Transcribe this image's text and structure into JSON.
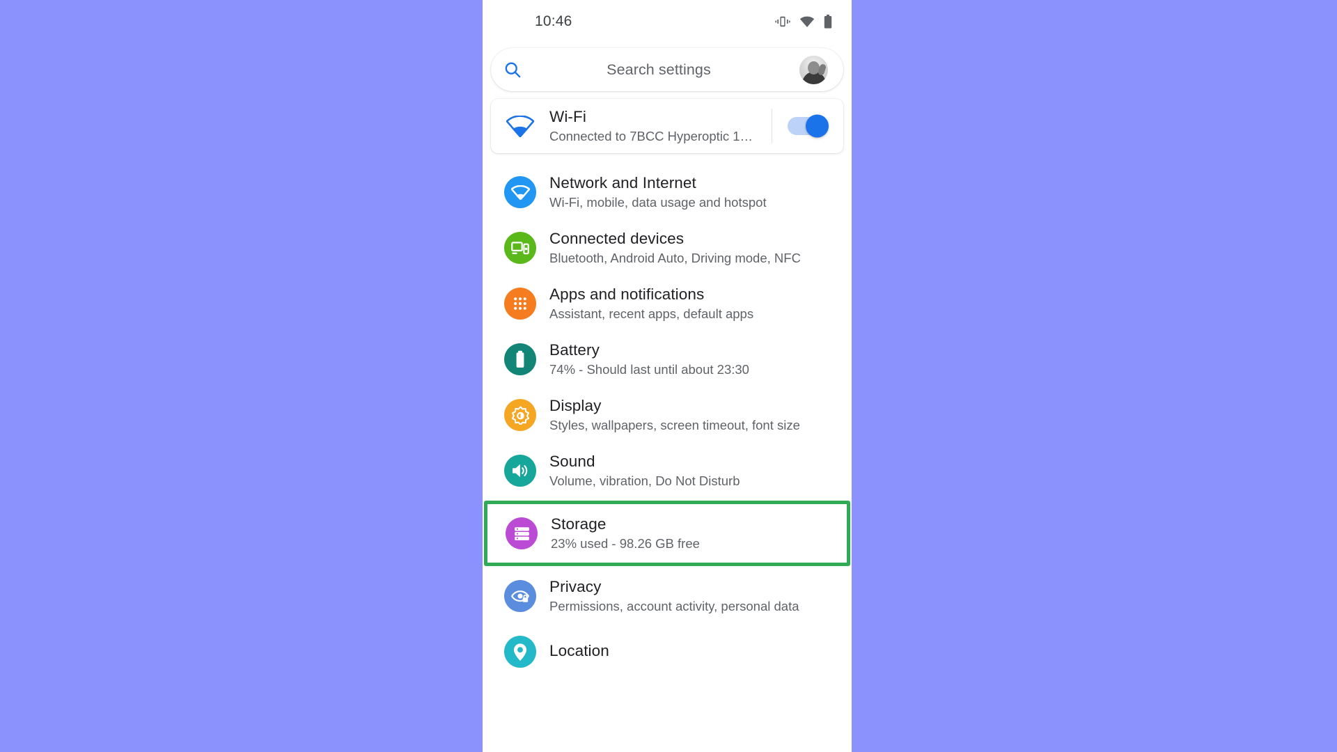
{
  "theme": {
    "background": "#8b92fd",
    "panel": "#ffffff",
    "accent_blue": "#1a73e8",
    "highlight_green": "#2fab55",
    "title_color": "#202124",
    "subtitle_color": "#5f6368"
  },
  "status_bar": {
    "clock": "10:46",
    "icons": [
      {
        "name": "vibrate-icon",
        "label": "Vibrate"
      },
      {
        "name": "wifi-icon",
        "label": "Wi-Fi"
      },
      {
        "name": "battery-icon",
        "label": "Battery"
      }
    ]
  },
  "search": {
    "placeholder": "Search settings",
    "icon": "search-icon",
    "avatar": "account-avatar"
  },
  "wifi_card": {
    "icon": "wifi-icon",
    "title": "Wi-Fi",
    "subtitle": "Connected to 7BCC Hyperoptic 1…",
    "toggle_state": "on"
  },
  "settings": {
    "items": [
      {
        "id": "network-and-internet",
        "icon": "wifi-icon",
        "icon_color": "#2196f3",
        "title": "Network and Internet",
        "subtitle": "Wi-Fi, mobile, data usage and hotspot",
        "highlighted": false
      },
      {
        "id": "connected-devices",
        "icon": "devices-icon",
        "icon_color": "#5bb81b",
        "title": "Connected devices",
        "subtitle": "Bluetooth, Android Auto, Driving mode, NFC",
        "highlighted": false
      },
      {
        "id": "apps-and-notifications",
        "icon": "apps-grid-icon",
        "icon_color": "#f57c1f",
        "title": "Apps and notifications",
        "subtitle": "Assistant, recent apps, default apps",
        "highlighted": false
      },
      {
        "id": "battery",
        "icon": "battery-icon",
        "icon_color": "#128577",
        "title": "Battery",
        "subtitle": "74% - Should last until about 23:30",
        "highlighted": false
      },
      {
        "id": "display",
        "icon": "brightness-icon",
        "icon_color": "#f5a623",
        "title": "Display",
        "subtitle": "Styles, wallpapers, screen timeout, font size",
        "highlighted": false
      },
      {
        "id": "sound",
        "icon": "volume-icon",
        "icon_color": "#16a79a",
        "title": "Sound",
        "subtitle": "Volume, vibration, Do Not Disturb",
        "highlighted": false
      },
      {
        "id": "storage",
        "icon": "storage-icon",
        "icon_color": "#bb4ad4",
        "title": "Storage",
        "subtitle": "23% used - 98.26 GB free",
        "highlighted": true
      },
      {
        "id": "privacy",
        "icon": "privacy-eye-lock-icon",
        "icon_color": "#5b8dde",
        "title": "Privacy",
        "subtitle": "Permissions, account activity, personal data",
        "highlighted": false
      },
      {
        "id": "location",
        "icon": "location-pin-icon",
        "icon_color": "#24b9c9",
        "title": "Location",
        "subtitle": "",
        "highlighted": false
      }
    ]
  }
}
